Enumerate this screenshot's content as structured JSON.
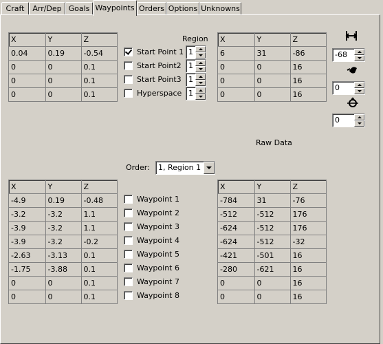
{
  "tabs": [
    "Craft",
    "Arr/Dep",
    "Goals",
    "Waypoints",
    "Orders",
    "Options",
    "Unknowns"
  ],
  "active_tab": "Waypoints",
  "start_points": {
    "region_label": "Region",
    "headers": [
      "X",
      "Y",
      "Z"
    ],
    "rows": [
      {
        "x": "0.04",
        "y": "0.19",
        "z": "-0.54",
        "label": "Start Point 1",
        "checked": true,
        "region": "1",
        "raw": [
          "6",
          "31",
          "-86"
        ]
      },
      {
        "x": "0",
        "y": "0",
        "z": "0.1",
        "label": "Start Point2",
        "checked": false,
        "region": "1",
        "raw": [
          "0",
          "0",
          "16"
        ]
      },
      {
        "x": "0",
        "y": "0",
        "z": "0.1",
        "label": "Start Point3",
        "checked": false,
        "region": "1",
        "raw": [
          "0",
          "0",
          "16"
        ]
      },
      {
        "x": "0",
        "y": "0",
        "z": "0.1",
        "label": "Hyperspace",
        "checked": false,
        "region": "1",
        "raw": [
          "0",
          "0",
          "16"
        ]
      }
    ]
  },
  "rotation": {
    "yaw": "-68",
    "pitch": "0",
    "roll": "0"
  },
  "raw_data_label": "Raw Data",
  "order": {
    "label": "Order:",
    "selected": "1, Region 1"
  },
  "waypoints": {
    "headers": [
      "X",
      "Y",
      "Z"
    ],
    "rows": [
      {
        "x": "-4.9",
        "y": "0.19",
        "z": "-0.48",
        "label": "Waypoint 1",
        "checked": false,
        "raw": [
          "-784",
          "31",
          "-76"
        ]
      },
      {
        "x": "-3.2",
        "y": "-3.2",
        "z": "1.1",
        "label": "Waypoint 2",
        "checked": false,
        "raw": [
          "-512",
          "-512",
          "176"
        ]
      },
      {
        "x": "-3.9",
        "y": "-3.2",
        "z": "1.1",
        "label": "Waypoint 3",
        "checked": false,
        "raw": [
          "-624",
          "-512",
          "176"
        ]
      },
      {
        "x": "-3.9",
        "y": "-3.2",
        "z": "-0.2",
        "label": "Waypoint 4",
        "checked": false,
        "raw": [
          "-624",
          "-512",
          "-32"
        ]
      },
      {
        "x": "-2.63",
        "y": "-3.13",
        "z": "0.1",
        "label": "Waypoint 5",
        "checked": false,
        "raw": [
          "-421",
          "-501",
          "16"
        ]
      },
      {
        "x": "-1.75",
        "y": "-3.88",
        "z": "0.1",
        "label": "Waypoint 6",
        "checked": false,
        "raw": [
          "-280",
          "-621",
          "16"
        ]
      },
      {
        "x": "0",
        "y": "0",
        "z": "0.1",
        "label": "Waypoint 7",
        "checked": false,
        "raw": [
          "0",
          "0",
          "16"
        ]
      },
      {
        "x": "0",
        "y": "0",
        "z": "0.1",
        "label": "Waypoint 8",
        "checked": false,
        "raw": [
          "0",
          "0",
          "16"
        ]
      }
    ]
  }
}
